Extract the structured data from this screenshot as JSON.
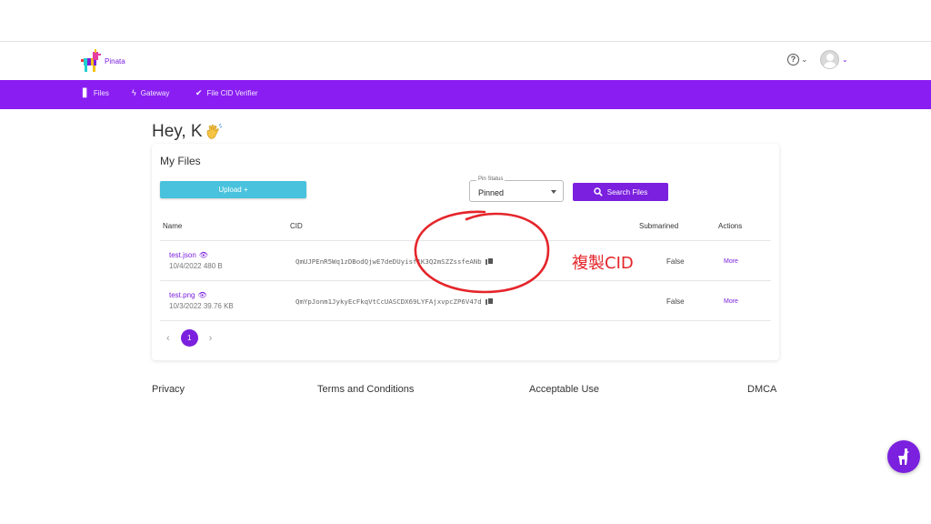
{
  "app": {
    "brand": "Pinata"
  },
  "header": {
    "help_icon": "question-circle-icon",
    "avatar_icon": "user-avatar-icon"
  },
  "nav": [
    {
      "label": "Files",
      "icon": "file-icon"
    },
    {
      "label": "Gateway",
      "icon": "lightning-icon"
    },
    {
      "label": "File CID Verifier",
      "icon": "double-check-icon"
    }
  ],
  "greeting": {
    "text": "Hey, K",
    "emoji": "wave-hand-icon"
  },
  "files_card": {
    "title": "My Files",
    "upload_label": "Upload +",
    "pin_status": {
      "legend": "Pin Status",
      "value": "Pinned"
    },
    "search_label": "Search Files",
    "columns": [
      "Name",
      "CID",
      "Submarined",
      "Actions"
    ],
    "rows": [
      {
        "name": "test.json",
        "date": "10/4/2022",
        "size": "480 B",
        "cid": "QmUJPEnR5Wq1zDBodQjwE7deDUyisf1K3Q2mSZZssfeANb",
        "submarined": "False",
        "action": "More"
      },
      {
        "name": "test.png",
        "date": "10/3/2022",
        "size": "39.76 KB",
        "cid": "QmYpJonm1JykyEcFkqVtCcUASCDX69LYFAjxvpcZP6V47d",
        "submarined": "False",
        "action": "More"
      }
    ],
    "pagination": {
      "current": "1"
    }
  },
  "annotation": {
    "text": "複製CID",
    "color": "#e4252a"
  },
  "footer": [
    "Privacy",
    "Terms and Conditions",
    "Acceptable Use",
    "DMCA"
  ],
  "colors": {
    "primary": "#7b20de",
    "nav": "#8a1ef2",
    "upload": "#48c2dd"
  }
}
